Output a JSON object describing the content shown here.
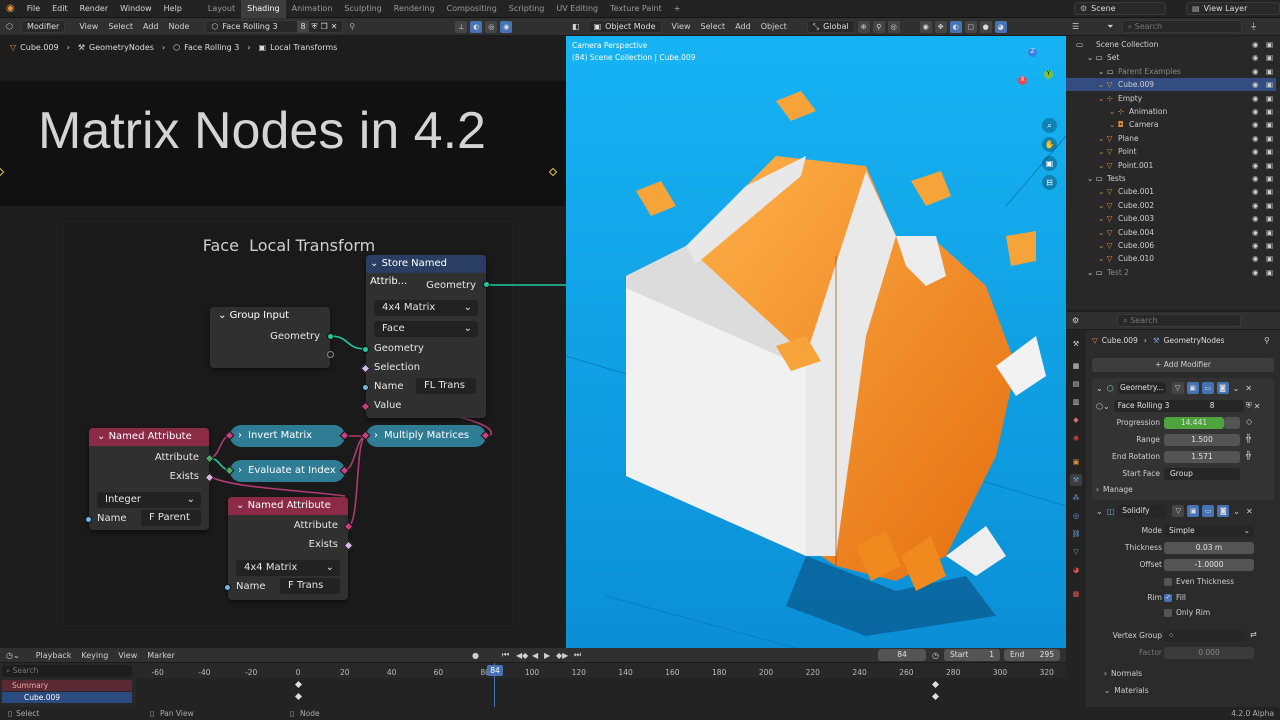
{
  "menu": {
    "items": [
      "File",
      "Edit",
      "Render",
      "Window",
      "Help"
    ]
  },
  "workspaces": [
    "Layout",
    "Shading",
    "Animation",
    "Sculpting",
    "Rendering",
    "Compositing",
    "Scripting",
    "UV Editing",
    "Texture Paint"
  ],
  "active_workspace": "Shading",
  "scene": {
    "label": "Scene",
    "view_layer": "View Layer"
  },
  "node_editor": {
    "header": {
      "mode": "Modifier",
      "menus": [
        "View",
        "Select",
        "Add",
        "Node"
      ],
      "tree_name": "Face Rolling 3",
      "users": "8"
    },
    "breadcrumb": [
      "Cube.009",
      "GeometryNodes",
      "Face Rolling 3",
      "Local Transforms"
    ],
    "frame_title": "Matrix Nodes in 4.2",
    "frame_subtitle": "Face  Local Transform",
    "nodes": {
      "store": {
        "title": "Store Named Attrib...",
        "geometry_out": "Geometry",
        "dtype": "4x4 Matrix",
        "domain": "Face",
        "geometry_in": "Geometry",
        "selection": "Selection",
        "name_label": "Name",
        "name_value": "FL Trans",
        "value": "Value"
      },
      "group_input": {
        "title": "Group Input",
        "geometry": "Geometry"
      },
      "named_attr_1": {
        "title": "Named Attribute",
        "attribute": "Attribute",
        "exists": "Exists",
        "dtype": "Integer",
        "name_label": "Name",
        "name_value": "F Parent"
      },
      "named_attr_2": {
        "title": "Named Attribute",
        "attribute": "Attribute",
        "exists": "Exists",
        "dtype": "4x4 Matrix",
        "name_label": "Name",
        "name_value": "F Trans"
      },
      "invert": {
        "title": "Invert Matrix"
      },
      "evaluate": {
        "title": "Evaluate at Index"
      },
      "multiply": {
        "title": "Multiply Matrices"
      }
    }
  },
  "viewport": {
    "menus": [
      "View",
      "Select",
      "Add",
      "Object"
    ],
    "mode": "Object Mode",
    "orientation": "Global",
    "overlay_title": "Camera Perspective",
    "overlay_sub": "(84) Scene Collection | Cube.009"
  },
  "outliner": {
    "search_placeholder": "Search",
    "rows": [
      {
        "label": "Scene Collection",
        "indent": 0,
        "icon": "collection"
      },
      {
        "label": "Set",
        "indent": 1,
        "icon": "collection"
      },
      {
        "label": "Parent Examples",
        "indent": 2,
        "icon": "collection",
        "dim": true
      },
      {
        "label": "Cube.009",
        "indent": 2,
        "icon": "mesh",
        "selected": true
      },
      {
        "label": "Empty",
        "indent": 2,
        "icon": "empty"
      },
      {
        "label": "Animation",
        "indent": 3,
        "icon": "empty"
      },
      {
        "label": "Camera",
        "indent": 3,
        "icon": "camera"
      },
      {
        "label": "Plane",
        "indent": 2,
        "icon": "mesh"
      },
      {
        "label": "Point",
        "indent": 2,
        "icon": "mesh"
      },
      {
        "label": "Point.001",
        "indent": 2,
        "icon": "mesh"
      },
      {
        "label": "Tests",
        "indent": 1,
        "icon": "collection"
      },
      {
        "label": "Cube.001",
        "indent": 2,
        "icon": "mesh"
      },
      {
        "label": "Cube.002",
        "indent": 2,
        "icon": "mesh"
      },
      {
        "label": "Cube.003",
        "indent": 2,
        "icon": "mesh"
      },
      {
        "label": "Cube.004",
        "indent": 2,
        "icon": "mesh"
      },
      {
        "label": "Cube.006",
        "indent": 2,
        "icon": "mesh"
      },
      {
        "label": "Cube.010",
        "indent": 2,
        "icon": "mesh"
      },
      {
        "label": "Test 2",
        "indent": 1,
        "icon": "collection",
        "dim": true
      }
    ]
  },
  "properties": {
    "search_placeholder": "Search",
    "breadcrumb": [
      "Cube.009",
      "GeometryNodes"
    ],
    "add_modifier": "Add Modifier",
    "gn_modifier": {
      "name": "Geometry...",
      "tree": "Face Rolling 3",
      "users": "8"
    },
    "params": [
      {
        "label": "Progression",
        "value": "14.441",
        "highlight": true
      },
      {
        "label": "Range",
        "value": "1.500"
      },
      {
        "label": "End Rotation",
        "value": "1.571"
      },
      {
        "label": "Start Face",
        "value": "Group"
      }
    ],
    "manage": "Manage",
    "solidify": {
      "name": "Solidify",
      "mode_label": "Mode",
      "mode": "Simple",
      "thickness_label": "Thickness",
      "thickness": "0.03 m",
      "offset_label": "Offset",
      "offset": "-1.0000",
      "even_thickness": "Even Thickness",
      "rim_label": "Rim",
      "fill": "Fill",
      "only_rim": "Only Rim",
      "vertex_group_label": "Vertex Group",
      "factor_label": "Factor",
      "factor": "0.000"
    },
    "sections": [
      "Normals",
      "Materials"
    ]
  },
  "timeline": {
    "menus": [
      "Playback",
      "Keying",
      "View",
      "Marker"
    ],
    "current_frame": "84",
    "start_label": "Start",
    "start": "1",
    "end_label": "End",
    "end": "295",
    "ticks": [
      "-60",
      "-40",
      "-20",
      "0",
      "20",
      "40",
      "60",
      "80",
      "100",
      "120",
      "140",
      "160",
      "180",
      "200",
      "220",
      "240",
      "260",
      "280",
      "300",
      "320"
    ],
    "tracks": [
      "Summary",
      "Cube.009"
    ],
    "search_placeholder": "Search"
  },
  "statusbar": {
    "select": "Select",
    "pan": "Pan View",
    "node": "Node",
    "version": "4.2.0 Alpha"
  },
  "colors": {
    "accent": "#4772b3",
    "viewport_bg": "#10a5e6",
    "orange": "#f08a1e",
    "matrix_socket": "#c7407f",
    "geometry_socket": "#00d6a3"
  }
}
